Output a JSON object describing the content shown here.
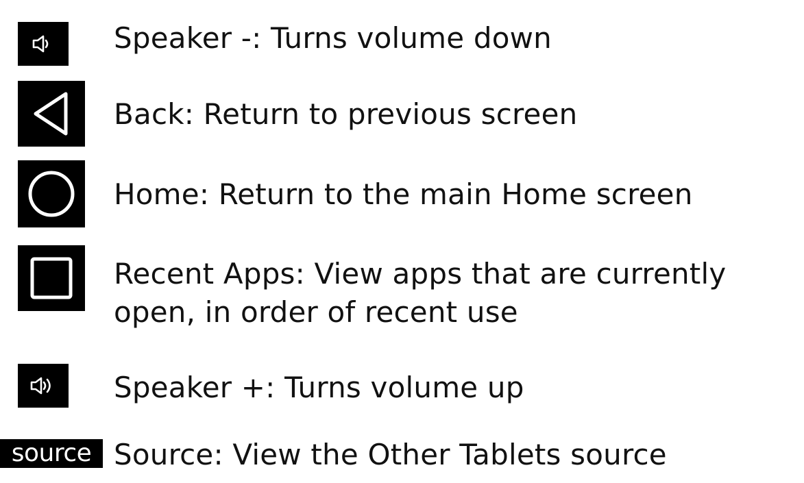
{
  "legend": {
    "items": [
      {
        "icon": "speaker-minus-icon",
        "label": "Speaker -: Turns volume down"
      },
      {
        "icon": "back-triangle-icon",
        "label": "Back: Return to previous screen"
      },
      {
        "icon": "home-circle-icon",
        "label": "Home: Return to the main Home screen"
      },
      {
        "icon": "recent-apps-square-icon",
        "label_line1": "Recent Apps: View apps that are currently",
        "label_line2": "open, in order of recent use"
      },
      {
        "icon": "speaker-plus-icon",
        "label": "Speaker +: Turns volume up"
      },
      {
        "icon": "source-text-icon",
        "icon_text": "source",
        "label": "Source: View the Other Tablets source"
      }
    ]
  },
  "colors": {
    "icon_background": "#000000",
    "icon_stroke": "#ffffff",
    "text": "#111111",
    "page_background": "#ffffff"
  }
}
